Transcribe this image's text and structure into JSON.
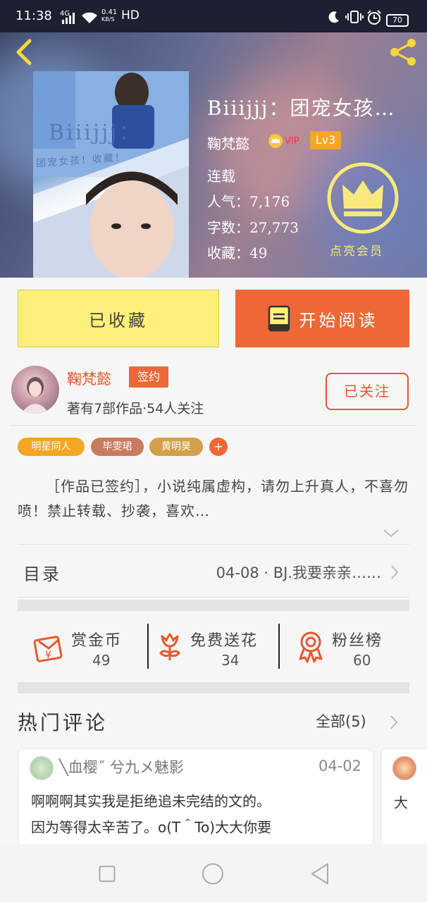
{
  "status_bar": {
    "time": "11:38",
    "network": "4G",
    "speed": "0.41",
    "speed_unit": "KB/S",
    "hd": "HD",
    "battery": "70"
  },
  "book": {
    "title": "Biiijjj：团宠女孩…",
    "author": "鞠梵懿",
    "vip_label": "VIP",
    "level": "Lv3",
    "status": "连载",
    "popularity_label": "人气：",
    "popularity": "7,176",
    "word_count_label": "字数：",
    "word_count": "27,773",
    "favorites_label": "收藏：",
    "favorites": "49",
    "member_label": "点亮会员",
    "cover_text_1": "Biiijjj：",
    "cover_text_2": "团宠女孩！收藏！"
  },
  "actions": {
    "collected": "已收藏",
    "start_reading": "开始阅读"
  },
  "author_info": {
    "name": "鞠梵懿",
    "badge": "签约",
    "stats": "著有7部作品·54人关注",
    "follow_label": "已关注"
  },
  "tags": [
    {
      "label": "明星同人",
      "color": "#f5a623"
    },
    {
      "label": "毕雯珺",
      "color": "#c97b5f"
    },
    {
      "label": "黄明昊",
      "color": "#d1a04a"
    },
    {
      "label": "+",
      "color": "#ee6837"
    }
  ],
  "description": "［作品已签约］，小说纯属虚构，请勿上升真人，不喜勿喷！禁止转载、抄袭，喜欢…",
  "toc": {
    "label": "目录",
    "latest": "04-08 · BJ.我要亲亲……"
  },
  "stats": [
    {
      "label": "赏金币",
      "value": "49",
      "icon": "red-envelope-icon"
    },
    {
      "label": "免费送花",
      "value": "34",
      "icon": "flower-icon"
    },
    {
      "label": "粉丝榜",
      "value": "60",
      "icon": "medal-icon"
    }
  ],
  "comments": {
    "title": "热门评论",
    "all_label": "全部(5)",
    "items": [
      {
        "user": "╲血樱˝ 兮九メ魅影",
        "date": "04-02",
        "text_line1": "啊啊啊其实我是拒绝追未完结的文的。",
        "text_line2": "因为等得太辛苦了。o(T＾To)大大你要"
      },
      {
        "user": "",
        "date": "",
        "text_line1": "大",
        "text_line2": ""
      }
    ]
  },
  "colors": {
    "accent_orange": "#ee6837",
    "accent_yellow": "#fdf07a",
    "crown_yellow": "#f7e97b"
  }
}
